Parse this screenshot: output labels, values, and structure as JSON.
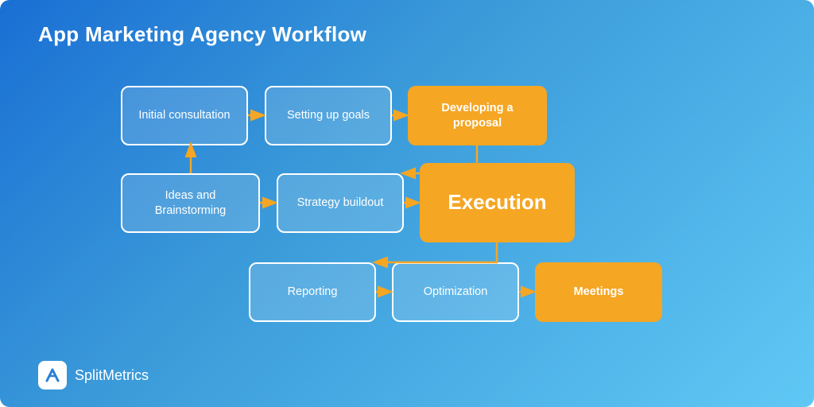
{
  "title": "App Marketing  Agency Workflow",
  "boxes": [
    {
      "id": "b1",
      "label": "Initial consultation",
      "style": "outline"
    },
    {
      "id": "b2",
      "label": "Setting up goals",
      "style": "outline"
    },
    {
      "id": "b3",
      "label": "Developing a proposal",
      "style": "orange"
    },
    {
      "id": "b4",
      "label": "Ideas and Brainstorming",
      "style": "outline"
    },
    {
      "id": "b5",
      "label": "Strategy buildout",
      "style": "outline"
    },
    {
      "id": "b6",
      "label": "Execution",
      "style": "orange-large"
    },
    {
      "id": "b7",
      "label": "Reporting",
      "style": "outline"
    },
    {
      "id": "b8",
      "label": "Optimization",
      "style": "outline"
    },
    {
      "id": "b9",
      "label": "Meetings",
      "style": "orange"
    }
  ],
  "logo": {
    "text_bold": "Split",
    "text_regular": "Metrics"
  },
  "arrow_color": "#F5A623"
}
